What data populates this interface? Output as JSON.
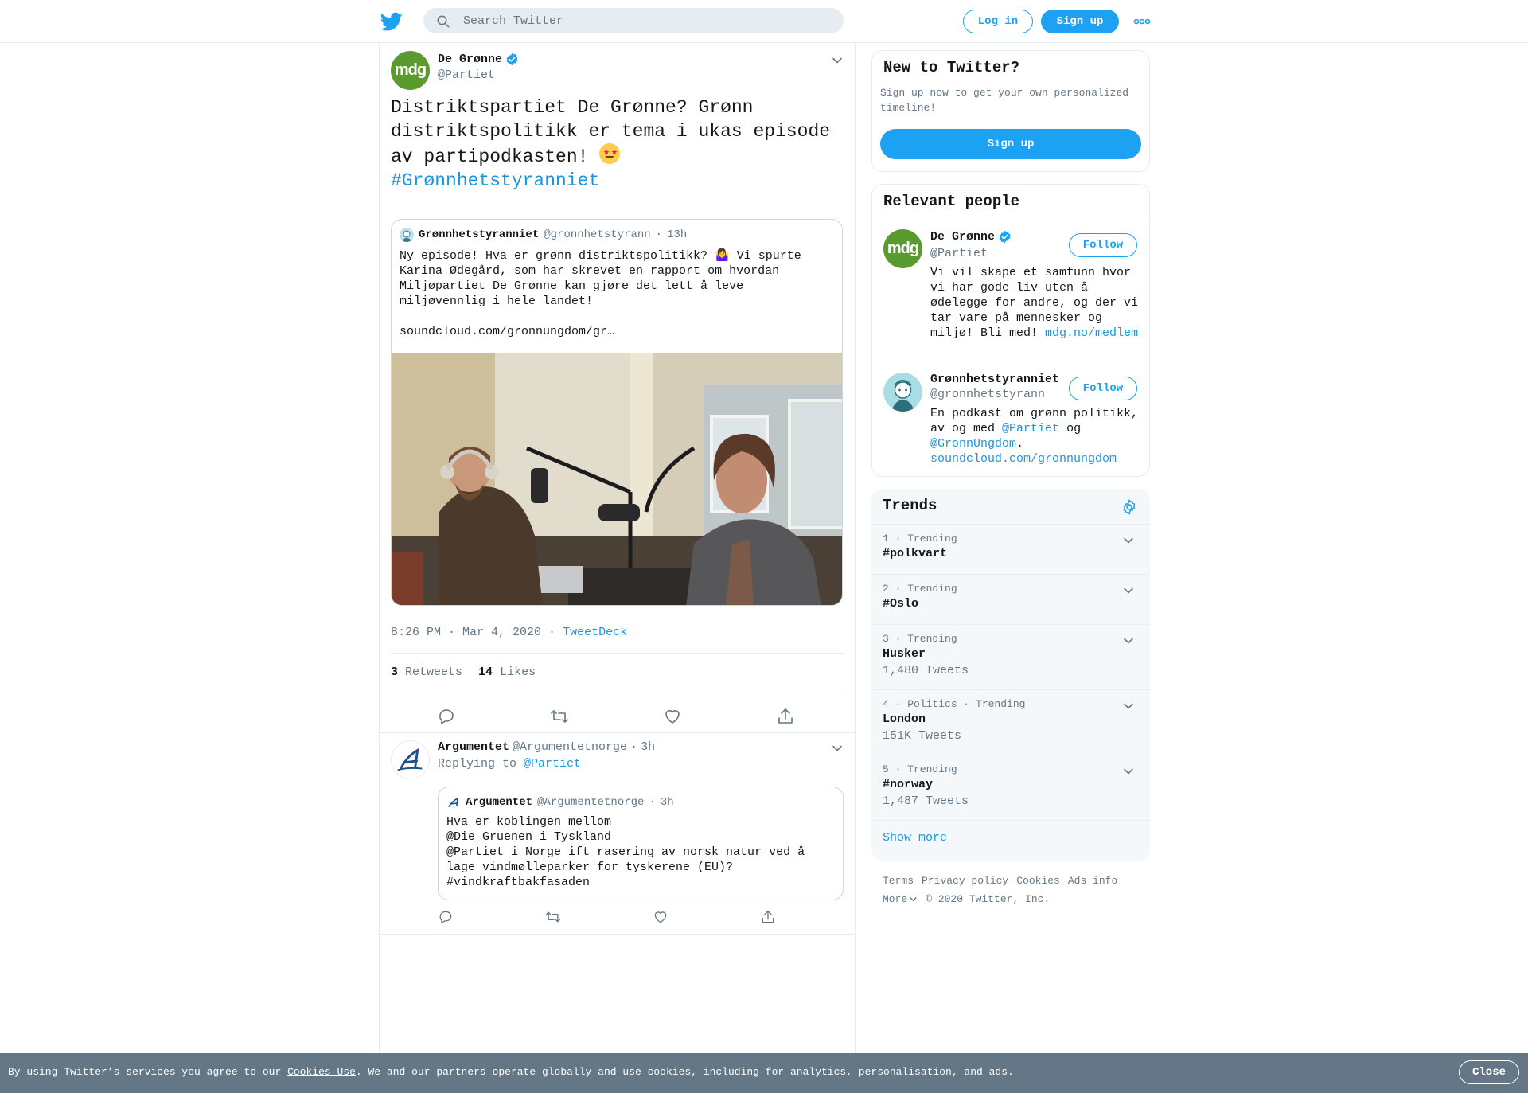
{
  "header": {
    "search_placeholder": "Search Twitter",
    "login_label": "Log in",
    "signup_label": "Sign up"
  },
  "tweet": {
    "author_name": "De Grønne",
    "author_handle": "@Partiet",
    "avatar_text": "mdg",
    "text": "Distriktspartiet De Grønne? Grønn distriktspolitikk er tema i ukas episode av partipodkasten!",
    "hashtag": "#Grønnhetstyranniet",
    "quote": {
      "author_name": "Grønnhetstyranniet",
      "author_handle": "@gronnhetstyrann",
      "time": "13h",
      "text_line1": "Ny episode! Hva er grønn distriktspolitikk? 🤷‍♀️ Vi spurte Karina Ødegård, som har skrevet en rapport om hvordan Miljøpartiet De Grønne kan gjøre det lett å leve miljøvennlig i hele landet!",
      "text_link": "soundcloud.com/gronnungdom/gr…"
    },
    "timestamp": "8:26 PM · Mar 4, 2020",
    "source": "TweetDeck",
    "retweets": "3",
    "retweets_label": "Retweets",
    "likes": "14",
    "likes_label": "Likes"
  },
  "reply": {
    "author_name": "Argumentet",
    "author_handle": "@Argumentetnorge",
    "time": "3h",
    "replying_prefix": "Replying to",
    "replying_to": "@Partiet",
    "quote": {
      "author_name": "Argumentet",
      "author_handle": "@Argumentetnorge",
      "time": "3h",
      "text": "Hva er koblingen mellom\n@Die_Gruenen i Tyskland\n@Partiet i Norge ift rasering av norsk natur ved å lage vindmølleparker for tyskerene (EU)?\n#vindkraftbakfasaden"
    }
  },
  "sidebar": {
    "new_to_twitter": {
      "title": "New to Twitter?",
      "description": "Sign up now to get your own personalized timeline!",
      "signup_label": "Sign up"
    },
    "relevant_people": {
      "title": "Relevant people",
      "follow_label": "Follow",
      "people": [
        {
          "name": "De Grønne",
          "handle": "@Partiet",
          "avatar_text": "mdg",
          "bio": "Vi vil skape et samfunn hvor vi har gode liv uten å ødelegge for andre, og der vi tar vare på mennesker og miljø! Bli med!",
          "bio_link": "mdg.no/medlem"
        },
        {
          "name": "Grønnhetstyranniet",
          "handle": "@gronnhetstyrann",
          "bio_part1": "En podkast om grønn politikk, av og med",
          "bio_mention1": "@Partiet",
          "bio_part2": "og",
          "bio_mention2": "@GronnUngdom",
          "bio_part3": ".",
          "bio_link": "soundcloud.com/gronnungdom"
        }
      ]
    },
    "trends": {
      "title": "Trends",
      "items": [
        {
          "meta": "1 · Trending",
          "name": "#polkvart",
          "count": ""
        },
        {
          "meta": "2 · Trending",
          "name": "#Oslo",
          "count": ""
        },
        {
          "meta": "3 · Trending",
          "name": "Husker",
          "count": "1,480 Tweets"
        },
        {
          "meta": "4 · Politics · Trending",
          "name": "London",
          "count": "151K Tweets"
        },
        {
          "meta": "5 · Trending",
          "name": "#norway",
          "count": "1,487 Tweets"
        }
      ],
      "show_more": "Show more"
    },
    "footer": {
      "links": [
        "Terms",
        "Privacy policy",
        "Cookies",
        "Ads info"
      ],
      "more": "More",
      "copyright": "© 2020 Twitter, Inc."
    }
  },
  "cookie_bar": {
    "text_before": "By using Twitter’s services you agree to our",
    "link": "Cookies Use",
    "text_after": ". We and our partners operate globally and use cookies, including for analytics, personalisation, and ads.",
    "close_label": "Close"
  },
  "colors": {
    "brand": "#1da1f2",
    "link": "#1b95e0",
    "mdg_green": "#5a9a2f",
    "cookie_bar": "#657786"
  }
}
